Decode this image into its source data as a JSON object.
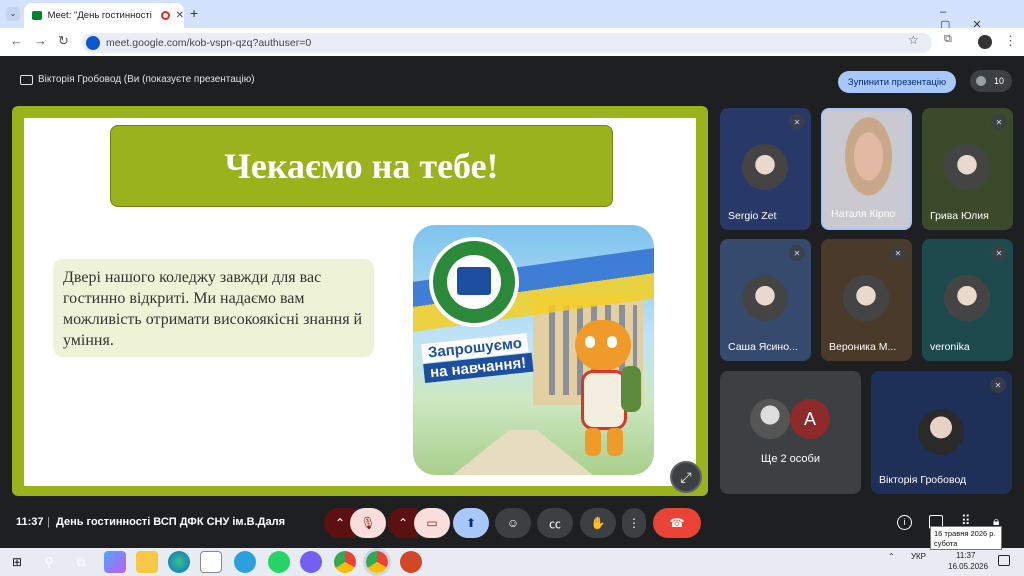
{
  "browser": {
    "tab_title": "Meet: \"День гостинності В",
    "url": "meet.google.com/kob-vspn-qzq?authuser=0"
  },
  "meet": {
    "presenter_text": "Вікторія Гробовод (Ви (показуєте презентацію)",
    "stop_button": "Зупинити презентацію",
    "participants_count": "10",
    "time": "11:37",
    "meeting_name": "День гостинності ВСП ДФК СНУ ім.В.Даля"
  },
  "slide": {
    "title": "Чекаємо на тебе!",
    "body": "Двері нашого коледжу завжди для вас гостинно відкриті. Ми надаємо вам можливість отримати високоякісні знання й уміння.",
    "poster_line1": "Запрошуємо",
    "poster_line2": "на навчання!"
  },
  "participants": [
    {
      "name": "Sergio Zet",
      "bg": "#283868"
    },
    {
      "name": "Наталя Кірпо",
      "bg": "#b89a8a"
    },
    {
      "name": "Грива Юлия",
      "bg": "#3a4a2a"
    },
    {
      "name": "Саша Ясино...",
      "bg": "#364a6e"
    },
    {
      "name": "Вероника М...",
      "bg": "#4a3a2a"
    },
    {
      "name": "veronika",
      "bg": "#1e4a4e"
    }
  ],
  "others": {
    "label": "Ще 2 особи",
    "avatar_letter": "A"
  },
  "self_tile": {
    "name": "Вікторія Гробовод",
    "bg": "#1f3058"
  },
  "taskbar": {
    "lang": "УКР",
    "time": "11:37",
    "date": "16.05.2026",
    "tooltip_line1": "16 травня 2026 р.",
    "tooltip_line2": "субота"
  },
  "colors": {
    "slide_green": "#9ab21c",
    "end_call": "#ea4335",
    "stop_btn": "#a8c7fa"
  }
}
